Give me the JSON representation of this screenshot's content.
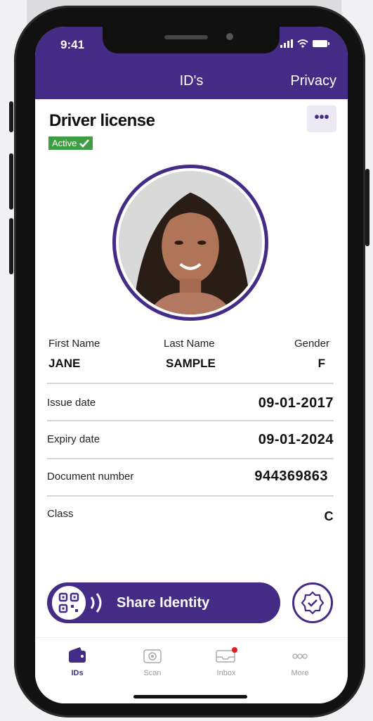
{
  "status": {
    "time": "9:41"
  },
  "nav": {
    "title": "ID's",
    "privacy": "Privacy"
  },
  "document": {
    "title": "Driver license",
    "status": "Active"
  },
  "fields": {
    "first_name_label": "First Name",
    "first_name": "JANE",
    "last_name_label": "Last Name",
    "last_name": "SAMPLE",
    "gender_label": "Gender",
    "gender": "F"
  },
  "rows": [
    {
      "label": "Issue date",
      "value": "09-01-2017"
    },
    {
      "label": "Expiry date",
      "value": "09-01-2024"
    },
    {
      "label": "Document number",
      "value": "944369863"
    },
    {
      "label": "Class",
      "value": "C"
    }
  ],
  "actions": {
    "share": "Share Identity"
  },
  "tabs": [
    {
      "label": "IDs",
      "icon": "wallet-icon"
    },
    {
      "label": "Scan",
      "icon": "camera-icon"
    },
    {
      "label": "Inbox",
      "icon": "inbox-icon"
    },
    {
      "label": "More",
      "icon": "more-icon"
    }
  ],
  "colors": {
    "brand": "#432b86",
    "active": "#3f9e43",
    "notification": "#e02020"
  }
}
